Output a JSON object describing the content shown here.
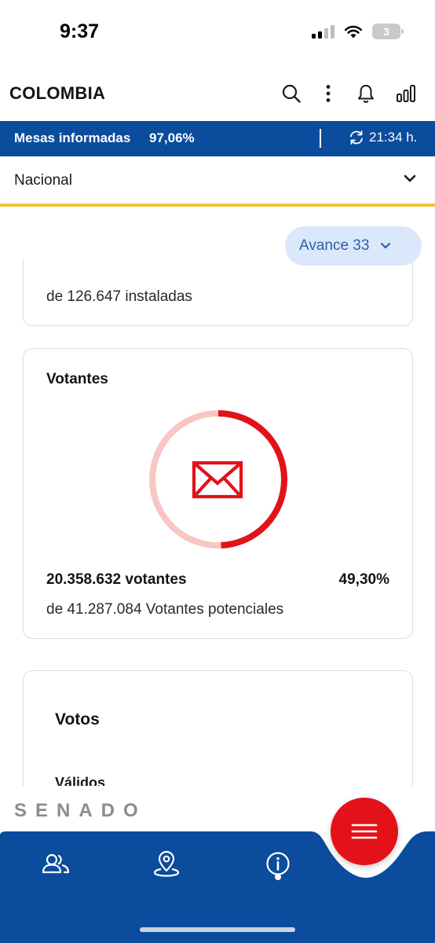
{
  "status_bar": {
    "time": "9:37",
    "battery_level": "3",
    "icons": [
      "signal-icon",
      "wifi-icon",
      "battery-icon"
    ]
  },
  "header": {
    "title": "COLOMBIA",
    "icons": [
      "search-icon",
      "more-vertical-icon",
      "bell-icon",
      "bar-chart-icon"
    ]
  },
  "info_bar": {
    "label": "Mesas informadas",
    "value": "97,06%",
    "updated_time": "21:34 h.",
    "icon": "refresh-icon"
  },
  "region": {
    "selected": "Nacional",
    "icon": "chevron-down-icon"
  },
  "avance": {
    "label": "Avance 33",
    "icon": "chevron-down-icon"
  },
  "mesas_card": {
    "sub_text": "de 126.647 instaladas"
  },
  "votantes_card": {
    "title": "Votantes",
    "count_text": "20.358.632 votantes",
    "percent_text": "49,30%",
    "percent_value": 49.3,
    "sub_text": "de 41.287.084 Votantes potenciales",
    "icon": "envelope-icon",
    "colors": {
      "filled": "#e3121a",
      "remaining": "#f8c6c3"
    }
  },
  "votos_card": {
    "title": "Votos",
    "subtitle": "Válidos"
  },
  "footer": {
    "section_label": "SENADO"
  },
  "bottom_nav": {
    "items": [
      {
        "name": "people-icon",
        "active": false
      },
      {
        "name": "location-pin-icon",
        "active": false
      },
      {
        "name": "info-icon",
        "active": true
      }
    ],
    "menu_icon": "hamburger-menu-icon",
    "colors": {
      "bar": "#0b4c9c",
      "fab": "#e3121a"
    }
  }
}
